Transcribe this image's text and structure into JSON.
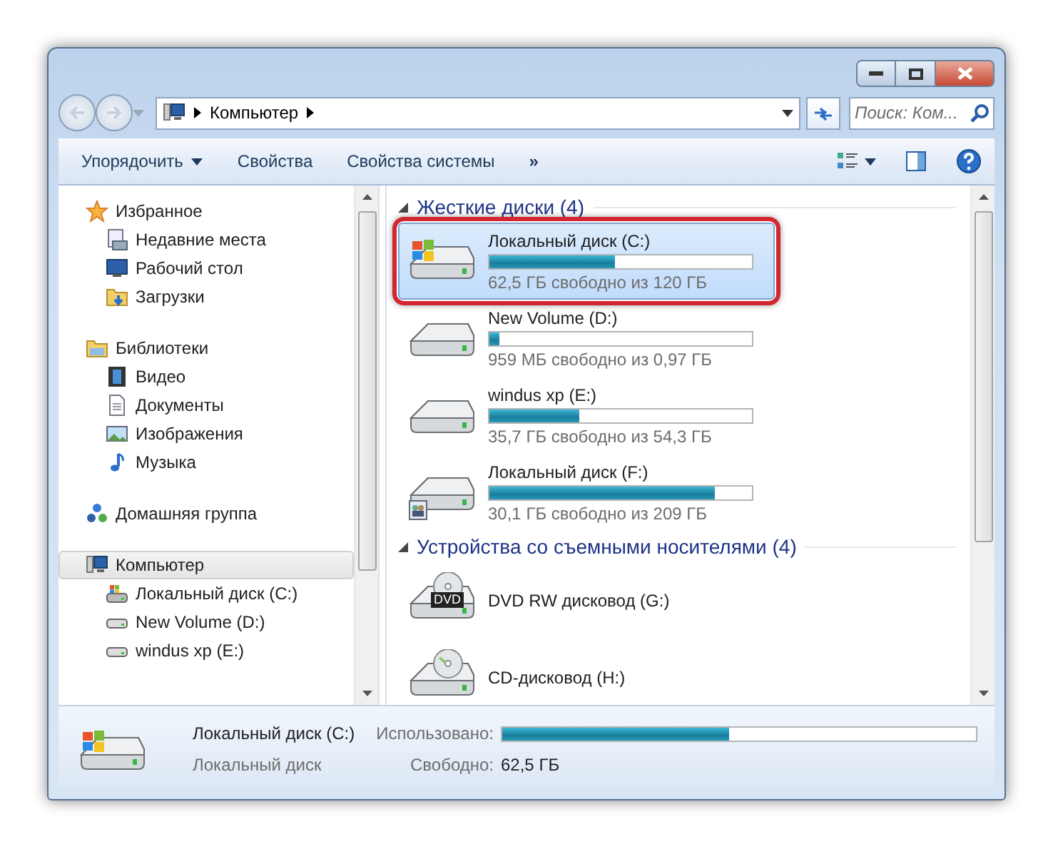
{
  "address_bar": {
    "path": [
      {
        "label": "Компьютер"
      }
    ]
  },
  "search": {
    "placeholder": "Поиск: Ком..."
  },
  "toolbar": {
    "buttons": [
      {
        "label": "Упорядочить",
        "dropdown": true
      },
      {
        "label": "Свойства",
        "dropdown": false
      },
      {
        "label": "Свойства системы",
        "dropdown": false
      }
    ],
    "overflow": "»"
  },
  "navigation": {
    "groups": [
      {
        "label": "Избранное",
        "kind": "favorites",
        "selected": false,
        "children": [
          {
            "label": "Недавние места",
            "kind": "recent",
            "selected": false
          },
          {
            "label": "Рабочий стол",
            "kind": "desktop",
            "selected": false
          },
          {
            "label": "Загрузки",
            "kind": "downloads",
            "selected": false
          }
        ]
      },
      {
        "label": "Библиотеки",
        "kind": "libraries",
        "selected": false,
        "children": [
          {
            "label": "Видео",
            "kind": "video",
            "selected": false
          },
          {
            "label": "Документы",
            "kind": "documents",
            "selected": false
          },
          {
            "label": "Изображения",
            "kind": "pictures",
            "selected": false
          },
          {
            "label": "Музыка",
            "kind": "music",
            "selected": false
          }
        ]
      },
      {
        "label": "Домашняя группа",
        "kind": "homegroup",
        "selected": false
      },
      {
        "label": "Компьютер",
        "kind": "computer",
        "selected": true,
        "children": [
          {
            "label": "Локальный диск (C:)",
            "kind": "system-drive",
            "selected": false
          },
          {
            "label": "New Volume (D:)",
            "kind": "drive",
            "selected": false
          },
          {
            "label": "windus xp (E:)",
            "kind": "drive",
            "selected": false
          }
        ]
      }
    ]
  },
  "content": {
    "groups": [
      {
        "title": "Жесткие диски (4)",
        "expanded": true,
        "drives": [
          {
            "name": "Локальный диск (C:)",
            "kind": "system",
            "level": 0.48,
            "free": "62,5 ГБ свободно из 120 ГБ",
            "selected": true,
            "highlighted": true
          },
          {
            "name": "New Volume (D:)",
            "kind": "local",
            "level": 0.04,
            "free": "959 МБ свободно из 0,97 ГБ",
            "selected": false,
            "highlighted": false
          },
          {
            "name": "windus xp (E:)",
            "kind": "local",
            "level": 0.34,
            "free": "35,7 ГБ свободно из 54,3 ГБ",
            "selected": false,
            "highlighted": false
          },
          {
            "name": "Локальный диск (F:)",
            "kind": "shared",
            "level": 0.86,
            "free": "30,1 ГБ свободно из 209 ГБ",
            "selected": false,
            "highlighted": false
          }
        ]
      },
      {
        "title": "Устройства со съемными носителями (4)",
        "expanded": true,
        "drives": [
          {
            "name": "DVD RW дисковод (G:)",
            "kind": "dvd",
            "icon_label": "DVD",
            "selected": false,
            "highlighted": false
          },
          {
            "name": "CD-дисковод (H:)",
            "kind": "cd",
            "selected": false,
            "highlighted": false
          }
        ]
      }
    ]
  },
  "details": {
    "name": "Локальный диск (C:)",
    "type": "Локальный диск",
    "used_label": "Использовано:",
    "level": 0.48,
    "free_label": "Свободно:",
    "free_value": "62,5 ГБ"
  }
}
